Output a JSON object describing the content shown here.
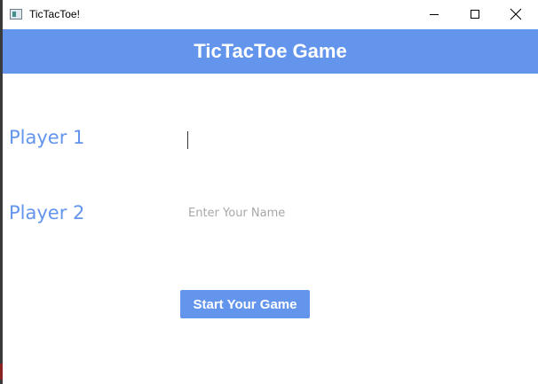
{
  "window": {
    "title": "TicTacToe!",
    "controls": [
      "minimize",
      "maximize",
      "close"
    ]
  },
  "header": {
    "title": "TicTacToe Game",
    "background": "#6495ed"
  },
  "form": {
    "player1": {
      "label": "Player 1",
      "value": "",
      "placeholder": "",
      "focused": true
    },
    "player2": {
      "label": "Player 2",
      "value": "",
      "placeholder": "Enter Your Name"
    },
    "start_button": {
      "label": "Start Your Game"
    }
  },
  "colors": {
    "accent": "#6495ed",
    "label_text": "#6495ed",
    "button_text": "#ffffff",
    "placeholder": "#a8a8a8"
  },
  "icons": {
    "app": "app-window-icon",
    "minimize": "minimize-icon",
    "maximize": "maximize-icon",
    "close": "close-icon"
  }
}
